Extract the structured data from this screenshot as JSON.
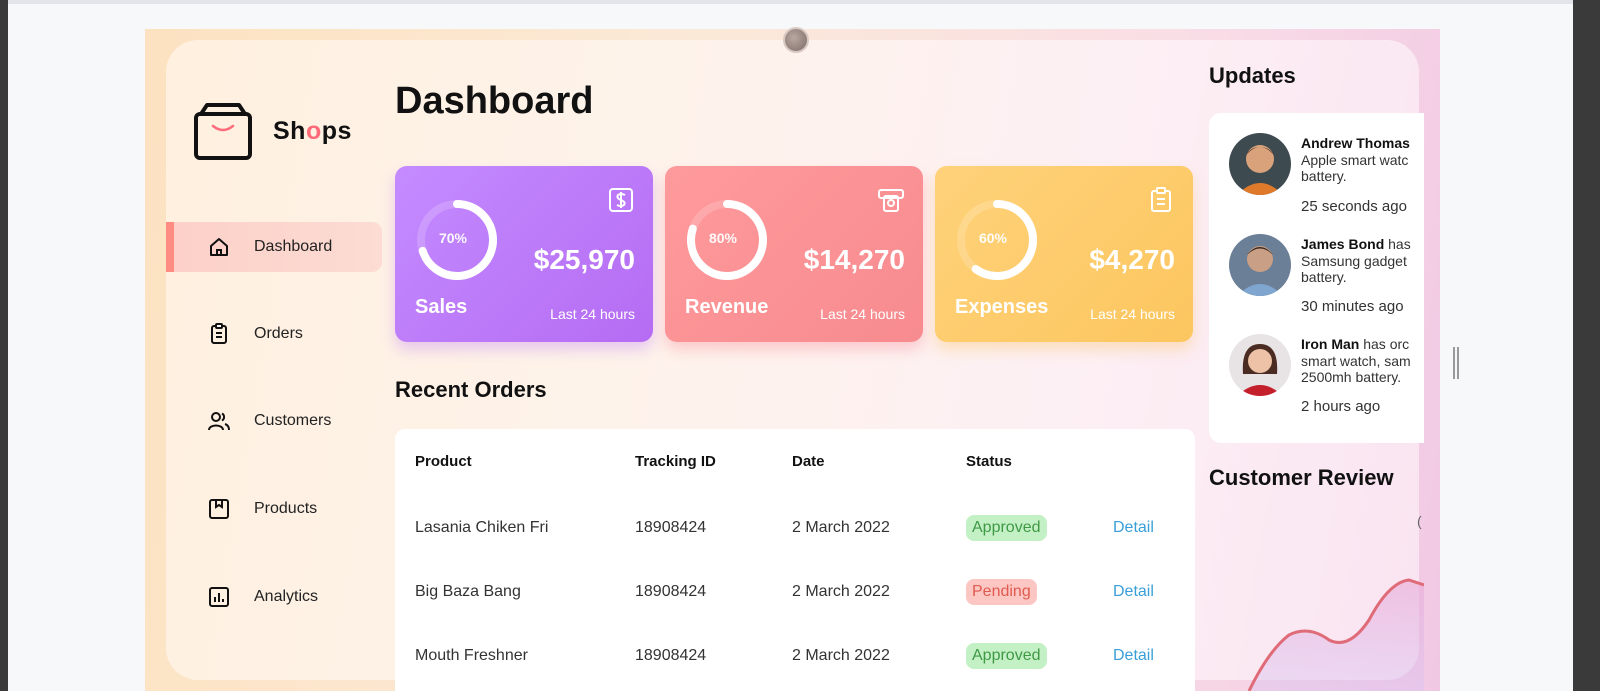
{
  "brand": {
    "name_prefix": "Sh",
    "name_accent": "o",
    "name_suffix": "ps"
  },
  "sidebar": {
    "items": [
      {
        "label": "Dashboard",
        "icon": "home-icon",
        "active": true
      },
      {
        "label": "Orders",
        "icon": "clipboard-icon",
        "active": false
      },
      {
        "label": "Customers",
        "icon": "users-icon",
        "active": false
      },
      {
        "label": "Products",
        "icon": "box-icon",
        "active": false
      },
      {
        "label": "Analytics",
        "icon": "chart-icon",
        "active": false
      }
    ]
  },
  "main": {
    "title": "Dashboard",
    "cards": [
      {
        "label": "Sales",
        "percent": "70%",
        "progress": 0.7,
        "value": "$25,970",
        "sub": "Last 24 hours",
        "icon": "dollar-icon",
        "color": "#b56cf3"
      },
      {
        "label": "Revenue",
        "percent": "80%",
        "progress": 0.8,
        "value": "$14,270",
        "sub": "Last 24 hours",
        "icon": "money-icon",
        "color": "#f78b8f"
      },
      {
        "label": "Expenses",
        "percent": "60%",
        "progress": 0.6,
        "value": "$4,270",
        "sub": "Last 24 hours",
        "icon": "clipboard-icon",
        "color": "#fcc65f"
      }
    ],
    "recent_orders": {
      "title": "Recent Orders",
      "columns": [
        "Product",
        "Tracking ID",
        "Date",
        "Status"
      ],
      "rows": [
        {
          "product": "Lasania Chiken Fri",
          "tracking": "18908424",
          "date": "2 March 2022",
          "status": "Approved",
          "action": "Detail"
        },
        {
          "product": "Big Baza Bang",
          "tracking": "18908424",
          "date": "2 March 2022",
          "status": "Pending",
          "action": "Detail"
        },
        {
          "product": "Mouth Freshner",
          "tracking": "18908424",
          "date": "2 March 2022",
          "status": "Approved",
          "action": "Detail"
        }
      ]
    }
  },
  "updates": {
    "title": "Updates",
    "items": [
      {
        "name": "Andrew Thomas",
        "line1_rest": "",
        "line2": "Apple smart watc",
        "line3": "battery.",
        "time": "25 seconds ago"
      },
      {
        "name": "James Bond",
        "line1_rest": " has",
        "line2": "Samsung gadget",
        "line3": "battery.",
        "time": "30 minutes ago"
      },
      {
        "name": "Iron Man",
        "line1_rest": " has orc",
        "line2": "smart watch, sam",
        "line3": "2500mh battery.",
        "time": "2 hours ago"
      }
    ]
  },
  "review": {
    "title": "Customer Review",
    "partial_label": "("
  },
  "colors": {
    "accent": "#ff8b82",
    "approved": "#3f9944",
    "pending": "#e05a4f",
    "link": "#3a9fd8"
  }
}
